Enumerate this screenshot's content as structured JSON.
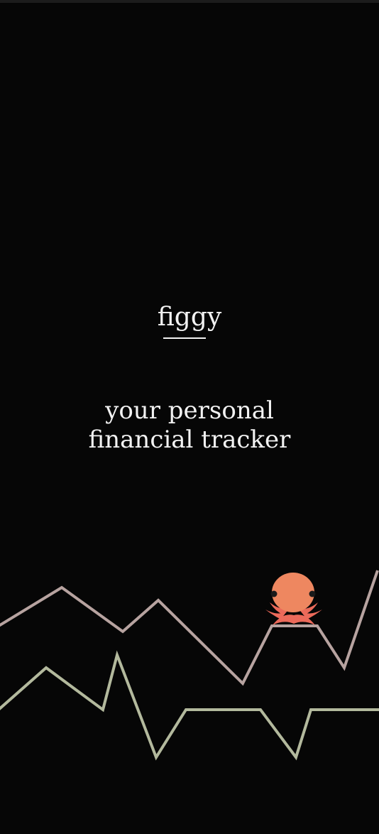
{
  "app": {
    "title": "figgy",
    "tagline_line1": "your personal",
    "tagline_line2": "financial tracker"
  },
  "colors": {
    "background": "#060606",
    "text": "#f2f2f2",
    "line_upper": "#b7a3a0",
    "line_lower": "#b3b99d",
    "mascot_body": "#ee8760",
    "mascot_tentacles": "#ec6a5a",
    "mascot_eyes": "#1a1a1a"
  },
  "decorations": {
    "mascot": "octopus-mascot-icon",
    "lines": [
      "decorative-line-upper",
      "decorative-line-lower"
    ]
  }
}
